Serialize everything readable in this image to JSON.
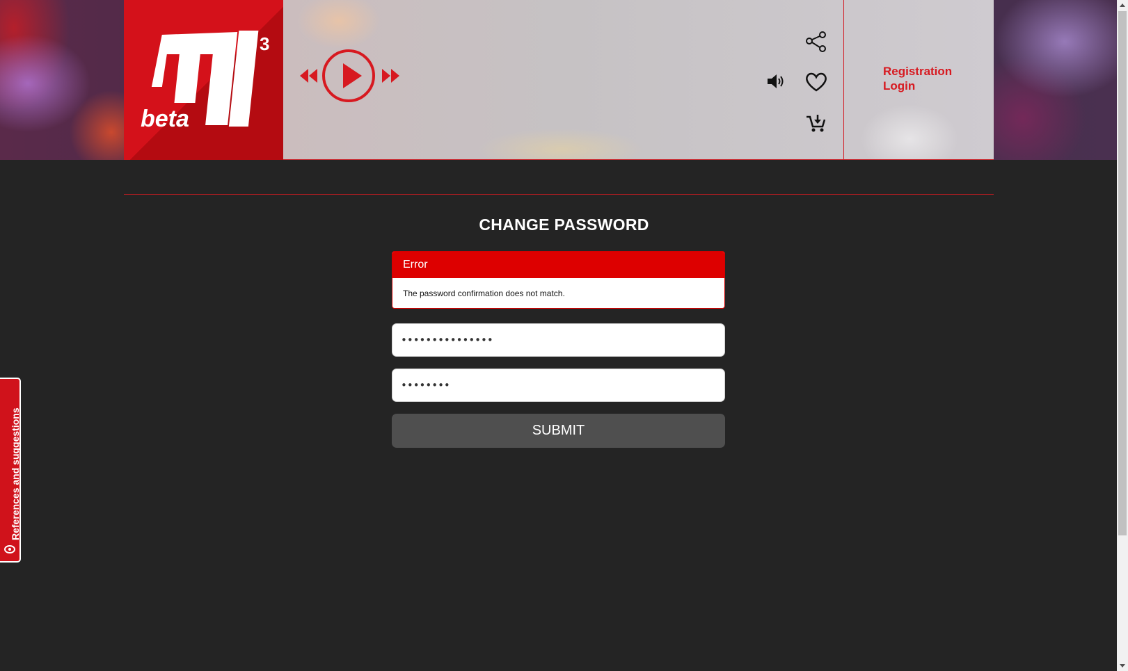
{
  "header": {
    "logo": {
      "text": "beta",
      "superscript": "3",
      "brand_color": "#d4111a"
    },
    "player": {
      "rewind_icon": "rewind-icon",
      "play_icon": "play-icon",
      "forward_icon": "fast-forward-icon"
    },
    "icons": {
      "share": "share-icon",
      "volume": "volume-icon",
      "favorite": "heart-icon",
      "cart": "add-to-cart-icon"
    },
    "auth": {
      "registration": "Registration",
      "login": "Login"
    }
  },
  "main": {
    "title": "CHANGE PASSWORD",
    "alert": {
      "title": "Error",
      "message": "The password confirmation does not match."
    },
    "password_field": {
      "value": "•••••••••••••••"
    },
    "confirm_field": {
      "value": "••••••••"
    },
    "submit_label": "SUBMIT"
  },
  "side_tab": {
    "label": "References and suggestions",
    "icon": "feedback-icon"
  },
  "colors": {
    "accent": "#d71920",
    "background": "#242424",
    "alert_header": "#dd0000",
    "button": "#4f4f4f"
  }
}
